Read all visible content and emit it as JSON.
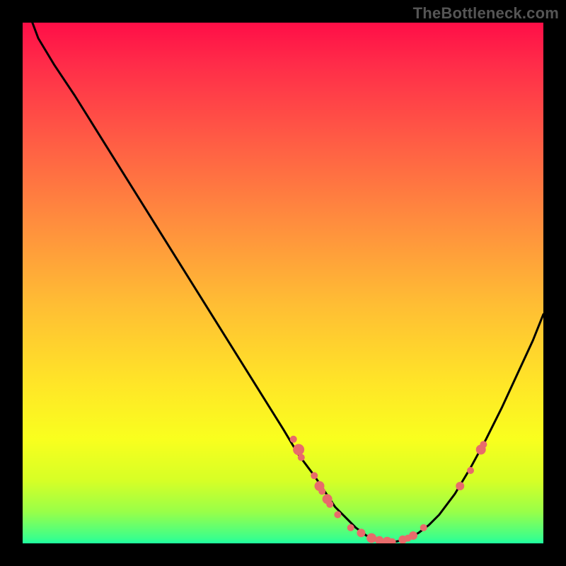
{
  "watermark": "TheBottleneck.com",
  "colors": {
    "curve": "#000000",
    "points": "#e86b6b",
    "background": "#000000"
  },
  "chart_data": {
    "type": "line",
    "title": "",
    "xlabel": "",
    "ylabel": "",
    "xlim": [
      0,
      100
    ],
    "ylim": [
      0,
      100
    ],
    "grid": false,
    "legend": false,
    "notes": "Bottleneck-style curve over a red-to-green vertical gradient. Y axis is inverted visually: high values plot near the bottom (green). Normalized 0–100 on both axes; no tick labels shown.",
    "series": [
      {
        "name": "bottleneck-curve",
        "x": [
          0,
          3,
          6,
          10,
          15,
          20,
          25,
          30,
          35,
          40,
          45,
          50,
          53,
          56,
          58,
          60,
          62,
          64,
          66,
          68,
          70,
          72,
          74,
          76,
          78,
          80,
          83,
          86,
          89,
          92,
          95,
          98,
          100
        ],
        "y": [
          -5,
          3,
          8,
          14,
          22,
          30,
          38,
          46,
          54,
          62,
          70,
          78,
          83,
          87,
          90,
          93,
          95,
          97,
          98.5,
          99.3,
          99.8,
          99.6,
          99,
          98,
          96.5,
          94.5,
          90.5,
          85.5,
          80,
          74,
          67.5,
          61,
          56
        ]
      }
    ],
    "scatter_points": {
      "name": "highlighted-points",
      "points": [
        {
          "x": 52,
          "y": 80,
          "r": 5
        },
        {
          "x": 53,
          "y": 82,
          "r": 8
        },
        {
          "x": 53.5,
          "y": 83.5,
          "r": 5
        },
        {
          "x": 56,
          "y": 87,
          "r": 5
        },
        {
          "x": 57,
          "y": 89,
          "r": 7
        },
        {
          "x": 57.5,
          "y": 90,
          "r": 5
        },
        {
          "x": 58.5,
          "y": 91.5,
          "r": 7
        },
        {
          "x": 59,
          "y": 92.5,
          "r": 5
        },
        {
          "x": 60.5,
          "y": 94.5,
          "r": 5
        },
        {
          "x": 63,
          "y": 97,
          "r": 5
        },
        {
          "x": 65,
          "y": 98,
          "r": 6
        },
        {
          "x": 67,
          "y": 99,
          "r": 7
        },
        {
          "x": 68.5,
          "y": 99.4,
          "r": 6
        },
        {
          "x": 70,
          "y": 99.7,
          "r": 7
        },
        {
          "x": 71,
          "y": 99.7,
          "r": 5
        },
        {
          "x": 73,
          "y": 99.3,
          "r": 6
        },
        {
          "x": 74,
          "y": 99,
          "r": 5
        },
        {
          "x": 75,
          "y": 98.5,
          "r": 6
        },
        {
          "x": 77,
          "y": 97,
          "r": 5
        },
        {
          "x": 84,
          "y": 89,
          "r": 6
        },
        {
          "x": 86,
          "y": 86,
          "r": 5
        },
        {
          "x": 88,
          "y": 82,
          "r": 7
        },
        {
          "x": 88.5,
          "y": 81,
          "r": 5
        }
      ]
    }
  }
}
